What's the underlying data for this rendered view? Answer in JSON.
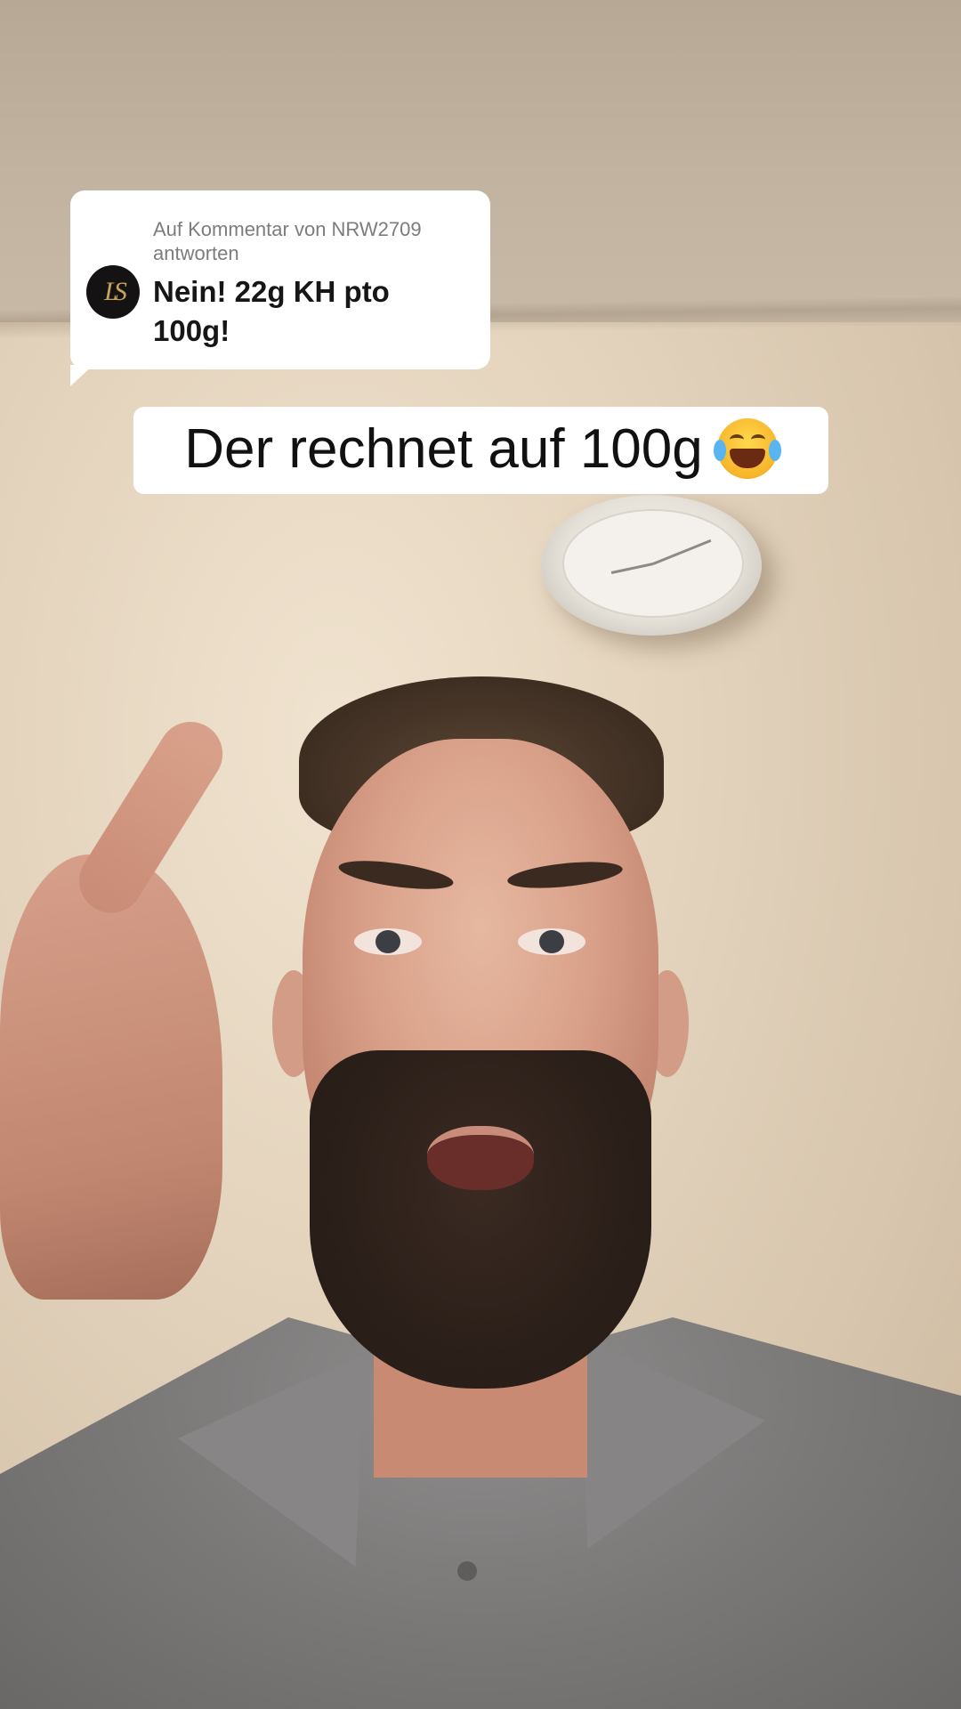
{
  "reply_card": {
    "avatar_monogram": "LS",
    "meta": "Auf Kommentar von NRW2709 antworten",
    "text": "Nein! 22g KH pto 100g!"
  },
  "caption": {
    "text": "Der rechnet auf 100g",
    "emoji_icon": "face-with-tears-of-joy-icon"
  },
  "colors": {
    "card_bg": "#ffffff",
    "meta_text": "#7c7c7c",
    "main_text": "#161616",
    "avatar_bg": "#141212",
    "avatar_gold": "#c9a35c"
  }
}
